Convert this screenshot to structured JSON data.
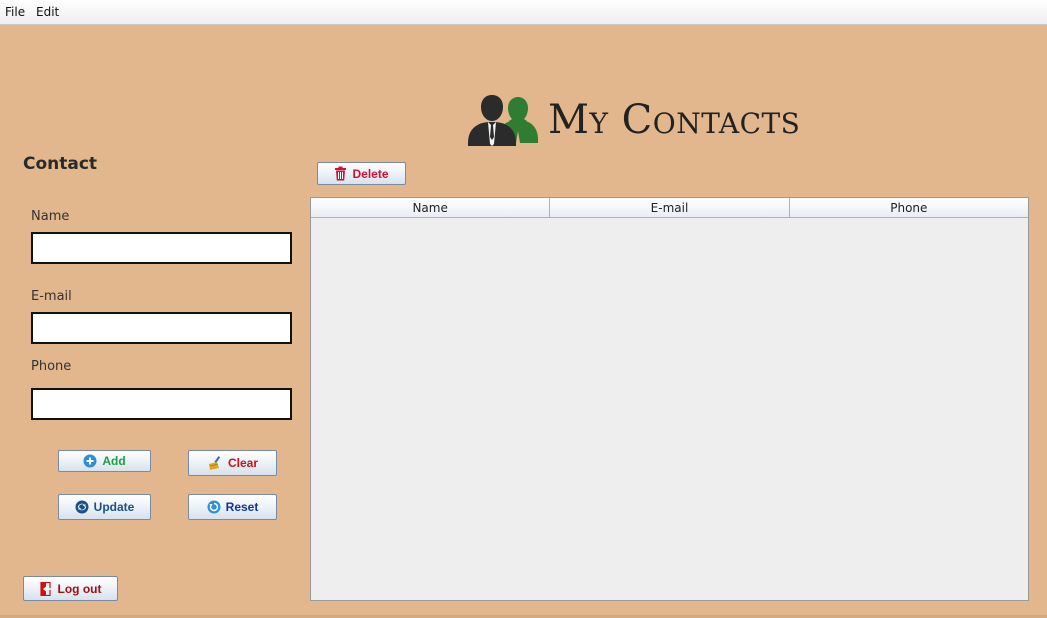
{
  "menu": {
    "file": "File",
    "edit": "Edit"
  },
  "app": {
    "title": "My Contacts"
  },
  "form": {
    "heading": "Contact",
    "name_label": "Name",
    "name_value": "",
    "email_label": "E-mail",
    "email_value": "",
    "phone_label": "Phone",
    "phone_value": ""
  },
  "buttons": {
    "add": "Add",
    "clear": "Clear",
    "update": "Update",
    "reset": "Reset",
    "delete": "Delete",
    "logout": "Log out"
  },
  "table": {
    "columns": [
      "Name",
      "E-mail",
      "Phone"
    ],
    "rows": []
  },
  "colors": {
    "background": "#e2b78e",
    "add": "#20a040",
    "clear": "#d01010",
    "update": "#1a4f8a",
    "reset": "#1034a6",
    "delete": "#d01030",
    "logout": "#a01010"
  },
  "icons": {
    "logo": "people-icon",
    "add": "plus-circle-icon",
    "clear": "broom-icon",
    "update": "refresh-icon",
    "reset": "reset-icon",
    "delete": "trash-icon",
    "logout": "exit-icon"
  }
}
